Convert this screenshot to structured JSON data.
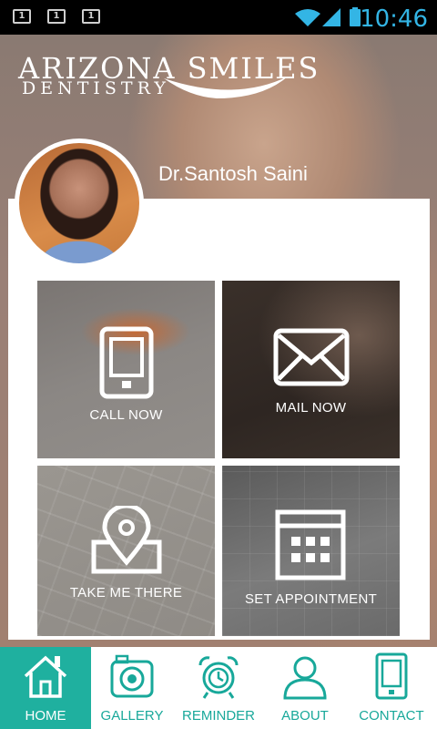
{
  "status_bar": {
    "time": "10:46",
    "notifications": [
      "1",
      "1",
      "1"
    ]
  },
  "logo": {
    "line1": "ARIZONA SMILES",
    "line2": "DENTISTRY"
  },
  "doctor": {
    "name": "Dr.Santosh Saini"
  },
  "tiles": {
    "call": "CALL NOW",
    "mail": "MAIL NOW",
    "directions": "TAKE ME THERE",
    "appointment": "SET APPOINTMENT"
  },
  "nav": {
    "home": "HOME",
    "gallery": "GALLERY",
    "reminder": "REMINDER",
    "about": "ABOUT",
    "contact": "CONTACT",
    "active": "home"
  },
  "colors": {
    "accent": "#1fb09f",
    "nav_text": "#18a89a",
    "clock": "#33b5e5"
  }
}
